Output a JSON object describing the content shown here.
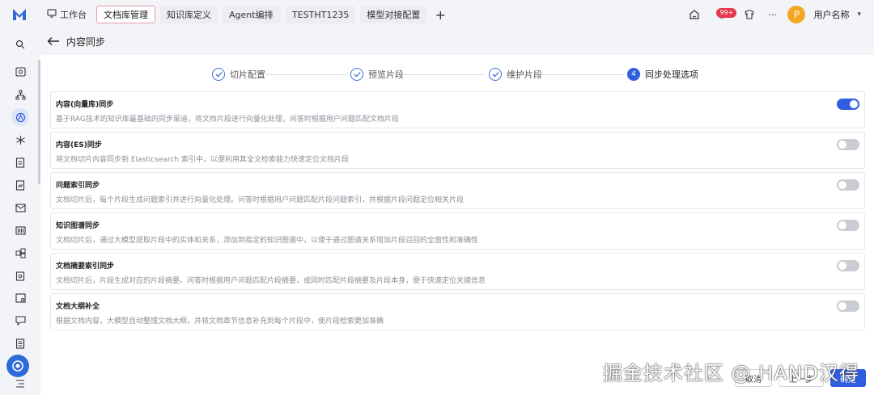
{
  "tabs": [
    {
      "label": "工作台"
    },
    {
      "label": "文档库管理"
    },
    {
      "label": "知识库定义"
    },
    {
      "label": "Agent编排"
    },
    {
      "label": "TESTHT1235"
    },
    {
      "label": "模型对接配置"
    }
  ],
  "header_right": {
    "notification_count": "99+",
    "user_initial": "P",
    "user_name": "用户名称",
    "more": "···"
  },
  "page": {
    "title": "内容同步"
  },
  "steps": [
    {
      "label": "切片配置",
      "state": "done"
    },
    {
      "label": "预览片段",
      "state": "done"
    },
    {
      "label": "维护片段",
      "state": "done"
    },
    {
      "label": "同步处理选项",
      "number": "4",
      "state": "current"
    }
  ],
  "options": [
    {
      "title": "内容(向量库)同步",
      "desc": "基于RAG技术的知识库最基础的同步渠道，将文档片段进行向量化处理，问答时根据用户问题匹配文档片段",
      "enabled": true
    },
    {
      "title": "内容(ES)同步",
      "desc": "将文档切片内容同步到 Elasticsearch 索引中，以便利用其全文检索能力快速定位文档片段",
      "enabled": false
    },
    {
      "title": "问题索引同步",
      "desc": "文档切片后，每个片段生成问题索引并进行向量化处理。问答时根据用户问题匹配片段问题索引，并根据片段问题定位相关片段",
      "enabled": false
    },
    {
      "title": "知识图谱同步",
      "desc": "文档切片后，通过大模型提取片段中的实体和关系，添加到指定的知识图谱中，以便于通过图谱关系增加片段召回的全面性和准确性",
      "enabled": false
    },
    {
      "title": "文档摘要索引同步",
      "desc": "文档切片后，片段生成对应的片段摘要。问答时根据用户问题匹配片段摘要，或同时匹配片段摘要及片段本身，便于快速定位关键信息",
      "enabled": false
    },
    {
      "title": "文档大纲补全",
      "desc": "根据文档内容，大模型自动整理文档大纲，并将文档章节信息补充到每个片段中，使片段检索更加准确",
      "enabled": false
    }
  ],
  "footer": {
    "cancel": "取消",
    "prev": "上一步",
    "confirm": "确定"
  },
  "watermark": "掘金技术社区 @ HAND汉得",
  "colors": {
    "primary": "#2f5fe0",
    "active_tab_border": "#e59aa8",
    "badge": "#e8364e",
    "avatar": "#f5a623"
  }
}
